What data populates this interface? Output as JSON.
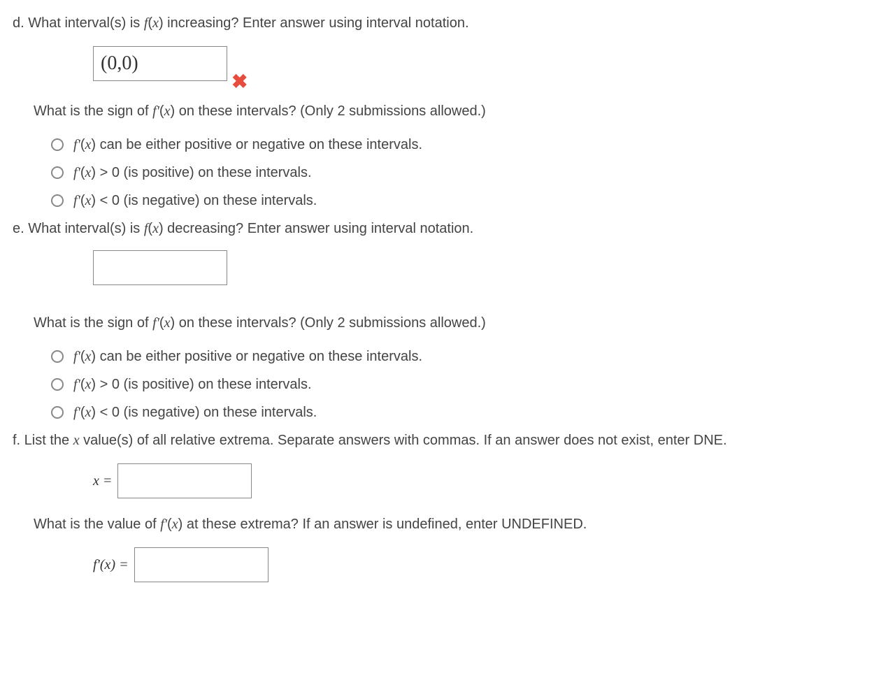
{
  "d": {
    "question": "d. What interval(s) is f(x) increasing? Enter answer using interval notation.",
    "answer_value": "(0,0)",
    "incorrect": true,
    "sub_question": "What is the sign of f'(x) on these intervals? (Only 2 submissions allowed.)",
    "options": [
      "f'(x) can be either positive or negative on these intervals.",
      "f'(x) > 0 (is positive) on these intervals.",
      "f'(x) < 0 (is negative) on these intervals."
    ]
  },
  "e": {
    "question": "e. What interval(s) is f(x) decreasing? Enter answer using interval notation.",
    "answer_value": "",
    "sub_question": "What is the sign of f'(x) on these intervals? (Only 2 submissions allowed.)",
    "options": [
      "f'(x) can be either positive or negative on these intervals.",
      "f'(x) > 0 (is positive) on these intervals.",
      "f'(x) < 0 (is negative) on these intervals."
    ]
  },
  "f": {
    "question": "f. List the x value(s) of all relative extrema. Separate answers with commas. If an answer does not exist, enter DNE.",
    "x_label": "x =",
    "x_value": "",
    "sub_question": "What is the value of f'(x) at these extrema? If an answer is undefined, enter UNDEFINED.",
    "fprime_label": "f'(x) =",
    "fprime_value": ""
  }
}
